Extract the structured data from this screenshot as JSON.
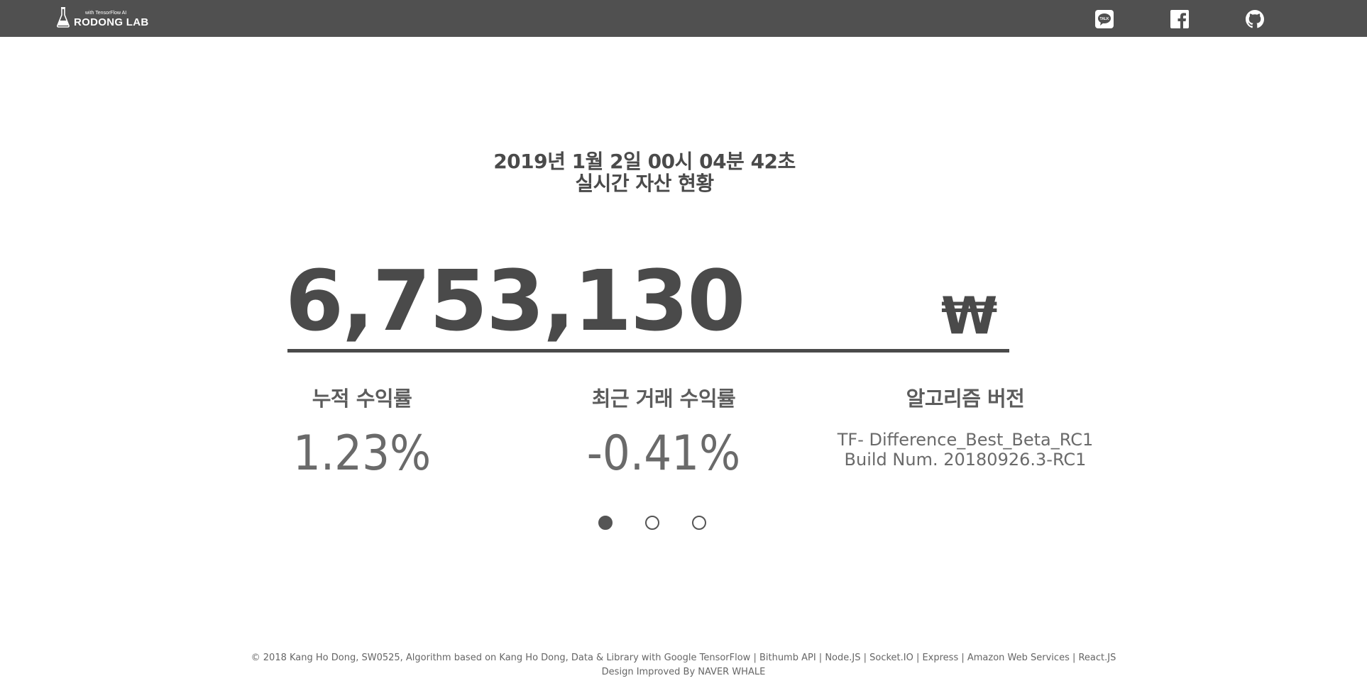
{
  "header": {
    "brand_sub": "with TensorFlow AI",
    "brand_name": "RODONG  LAB",
    "social": [
      {
        "name": "kakaotalk",
        "icon": "talk-icon"
      },
      {
        "name": "facebook",
        "icon": "facebook-icon"
      },
      {
        "name": "github",
        "icon": "github-icon"
      }
    ],
    "bg_color": "#505050"
  },
  "main": {
    "timestamp": "2019년 1월 2일 00시 04분 42초",
    "subtitle": "실시간 자산 현황",
    "total_asset": "6,753,130",
    "currency": "₩",
    "stats": [
      {
        "label": "누적 수익률",
        "value": "1.23%"
      },
      {
        "label": "최근 거래 수익률",
        "value": "-0.41%"
      },
      {
        "label": "알고리즘 버전",
        "line1": "TF- Difference_Best_Beta_RC1",
        "line2": "Build Num. 20180926.3-RC1"
      }
    ],
    "carousel": {
      "count": 3,
      "active_index": 0
    }
  },
  "footer": {
    "line1": "© 2018 Kang Ho Dong, SW0525, Algorithm based on Kang Ho Dong, Data & Library with Google TensorFlow | Bithumb API | Node.JS | Socket.IO | Express | Amazon Web Services | React.JS",
    "line2": "Design Improved By NAVER WHALE"
  }
}
